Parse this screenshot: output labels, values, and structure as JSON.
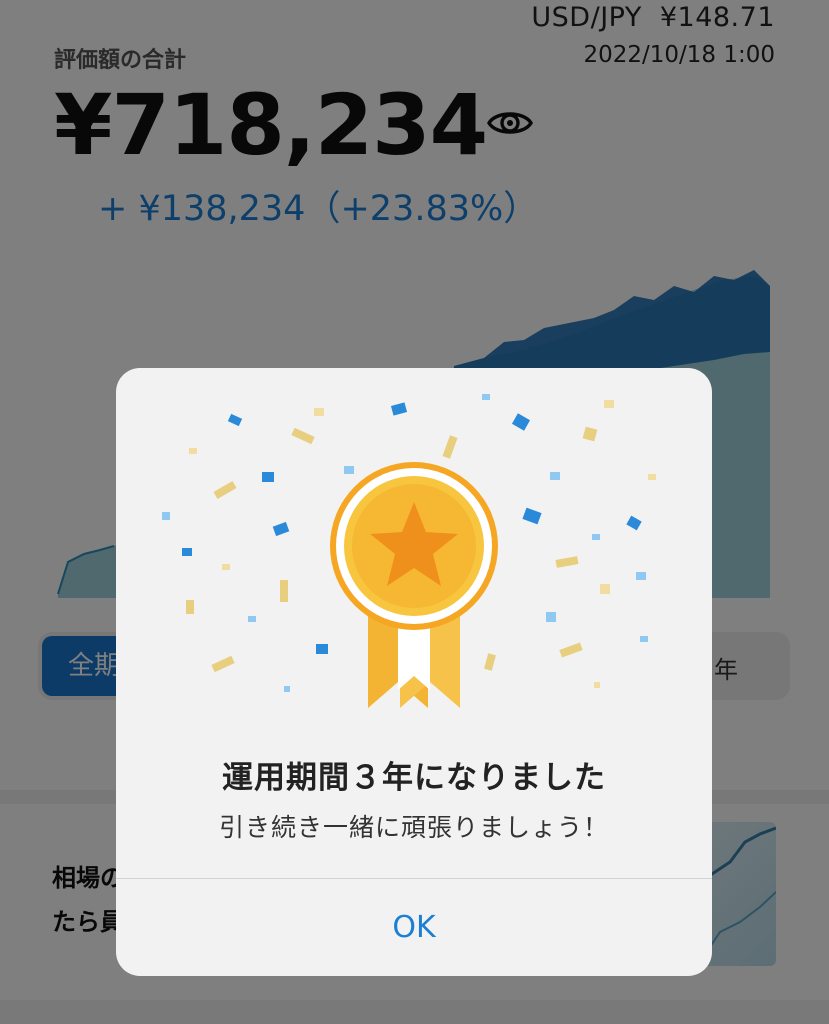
{
  "header": {
    "currency_pair": "USD/JPY",
    "rate": "¥148.71",
    "timestamp": "2022/10/18 1:00",
    "total_label": "評価額の合計",
    "total_value": "¥718,234",
    "change": "+ ¥138,234（+23.83%）"
  },
  "icons": {
    "visibility": "eye-icon",
    "medal": "medal-star-icon"
  },
  "period_tabs": {
    "active_label": "全期",
    "right_label": "年"
  },
  "news": {
    "line1": "相場の",
    "line2": "たら員"
  },
  "modal": {
    "title": "運用期間３年になりました",
    "subtitle": "引き続き一緒に頑張りましょう！",
    "ok_label": "OK"
  },
  "colors": {
    "accent": "#1b7fd4",
    "chart_total": "#1f6fb2",
    "chart_principal": "#8ecbd6",
    "medal_gold": "#f7b733",
    "overlay": "rgba(0,0,0,0.5)"
  }
}
